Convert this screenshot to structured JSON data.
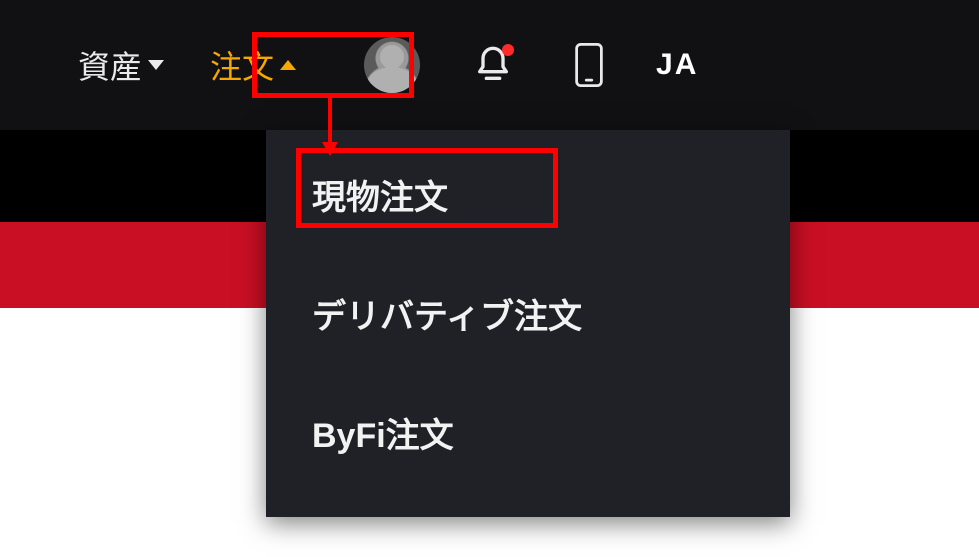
{
  "nav": {
    "assets_label": "資産",
    "orders_label": "注文"
  },
  "lang": "JA",
  "dropdown": {
    "items": [
      {
        "label": "現物注文"
      },
      {
        "label": "デリバティブ注文"
      },
      {
        "label": "ByFi注文"
      }
    ]
  },
  "highlight_color": "#ff0000",
  "accent_color": "#f6a800",
  "strip_red": "#c90f23"
}
